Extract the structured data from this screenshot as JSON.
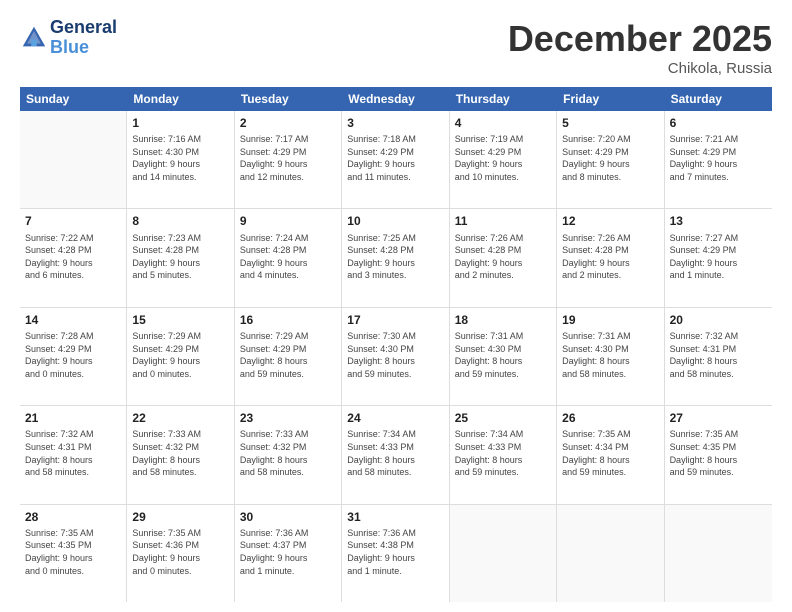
{
  "logo": {
    "line1": "General",
    "line2": "Blue"
  },
  "title": "December 2025",
  "location": "Chikola, Russia",
  "header_days": [
    "Sunday",
    "Monday",
    "Tuesday",
    "Wednesday",
    "Thursday",
    "Friday",
    "Saturday"
  ],
  "weeks": [
    [
      {
        "day": "",
        "info": ""
      },
      {
        "day": "1",
        "info": "Sunrise: 7:16 AM\nSunset: 4:30 PM\nDaylight: 9 hours\nand 14 minutes."
      },
      {
        "day": "2",
        "info": "Sunrise: 7:17 AM\nSunset: 4:29 PM\nDaylight: 9 hours\nand 12 minutes."
      },
      {
        "day": "3",
        "info": "Sunrise: 7:18 AM\nSunset: 4:29 PM\nDaylight: 9 hours\nand 11 minutes."
      },
      {
        "day": "4",
        "info": "Sunrise: 7:19 AM\nSunset: 4:29 PM\nDaylight: 9 hours\nand 10 minutes."
      },
      {
        "day": "5",
        "info": "Sunrise: 7:20 AM\nSunset: 4:29 PM\nDaylight: 9 hours\nand 8 minutes."
      },
      {
        "day": "6",
        "info": "Sunrise: 7:21 AM\nSunset: 4:29 PM\nDaylight: 9 hours\nand 7 minutes."
      }
    ],
    [
      {
        "day": "7",
        "info": "Sunrise: 7:22 AM\nSunset: 4:28 PM\nDaylight: 9 hours\nand 6 minutes."
      },
      {
        "day": "8",
        "info": "Sunrise: 7:23 AM\nSunset: 4:28 PM\nDaylight: 9 hours\nand 5 minutes."
      },
      {
        "day": "9",
        "info": "Sunrise: 7:24 AM\nSunset: 4:28 PM\nDaylight: 9 hours\nand 4 minutes."
      },
      {
        "day": "10",
        "info": "Sunrise: 7:25 AM\nSunset: 4:28 PM\nDaylight: 9 hours\nand 3 minutes."
      },
      {
        "day": "11",
        "info": "Sunrise: 7:26 AM\nSunset: 4:28 PM\nDaylight: 9 hours\nand 2 minutes."
      },
      {
        "day": "12",
        "info": "Sunrise: 7:26 AM\nSunset: 4:28 PM\nDaylight: 9 hours\nand 2 minutes."
      },
      {
        "day": "13",
        "info": "Sunrise: 7:27 AM\nSunset: 4:29 PM\nDaylight: 9 hours\nand 1 minute."
      }
    ],
    [
      {
        "day": "14",
        "info": "Sunrise: 7:28 AM\nSunset: 4:29 PM\nDaylight: 9 hours\nand 0 minutes."
      },
      {
        "day": "15",
        "info": "Sunrise: 7:29 AM\nSunset: 4:29 PM\nDaylight: 9 hours\nand 0 minutes."
      },
      {
        "day": "16",
        "info": "Sunrise: 7:29 AM\nSunset: 4:29 PM\nDaylight: 8 hours\nand 59 minutes."
      },
      {
        "day": "17",
        "info": "Sunrise: 7:30 AM\nSunset: 4:30 PM\nDaylight: 8 hours\nand 59 minutes."
      },
      {
        "day": "18",
        "info": "Sunrise: 7:31 AM\nSunset: 4:30 PM\nDaylight: 8 hours\nand 59 minutes."
      },
      {
        "day": "19",
        "info": "Sunrise: 7:31 AM\nSunset: 4:30 PM\nDaylight: 8 hours\nand 58 minutes."
      },
      {
        "day": "20",
        "info": "Sunrise: 7:32 AM\nSunset: 4:31 PM\nDaylight: 8 hours\nand 58 minutes."
      }
    ],
    [
      {
        "day": "21",
        "info": "Sunrise: 7:32 AM\nSunset: 4:31 PM\nDaylight: 8 hours\nand 58 minutes."
      },
      {
        "day": "22",
        "info": "Sunrise: 7:33 AM\nSunset: 4:32 PM\nDaylight: 8 hours\nand 58 minutes."
      },
      {
        "day": "23",
        "info": "Sunrise: 7:33 AM\nSunset: 4:32 PM\nDaylight: 8 hours\nand 58 minutes."
      },
      {
        "day": "24",
        "info": "Sunrise: 7:34 AM\nSunset: 4:33 PM\nDaylight: 8 hours\nand 58 minutes."
      },
      {
        "day": "25",
        "info": "Sunrise: 7:34 AM\nSunset: 4:33 PM\nDaylight: 8 hours\nand 59 minutes."
      },
      {
        "day": "26",
        "info": "Sunrise: 7:35 AM\nSunset: 4:34 PM\nDaylight: 8 hours\nand 59 minutes."
      },
      {
        "day": "27",
        "info": "Sunrise: 7:35 AM\nSunset: 4:35 PM\nDaylight: 8 hours\nand 59 minutes."
      }
    ],
    [
      {
        "day": "28",
        "info": "Sunrise: 7:35 AM\nSunset: 4:35 PM\nDaylight: 9 hours\nand 0 minutes."
      },
      {
        "day": "29",
        "info": "Sunrise: 7:35 AM\nSunset: 4:36 PM\nDaylight: 9 hours\nand 0 minutes."
      },
      {
        "day": "30",
        "info": "Sunrise: 7:36 AM\nSunset: 4:37 PM\nDaylight: 9 hours\nand 1 minute."
      },
      {
        "day": "31",
        "info": "Sunrise: 7:36 AM\nSunset: 4:38 PM\nDaylight: 9 hours\nand 1 minute."
      },
      {
        "day": "",
        "info": ""
      },
      {
        "day": "",
        "info": ""
      },
      {
        "day": "",
        "info": ""
      }
    ]
  ]
}
